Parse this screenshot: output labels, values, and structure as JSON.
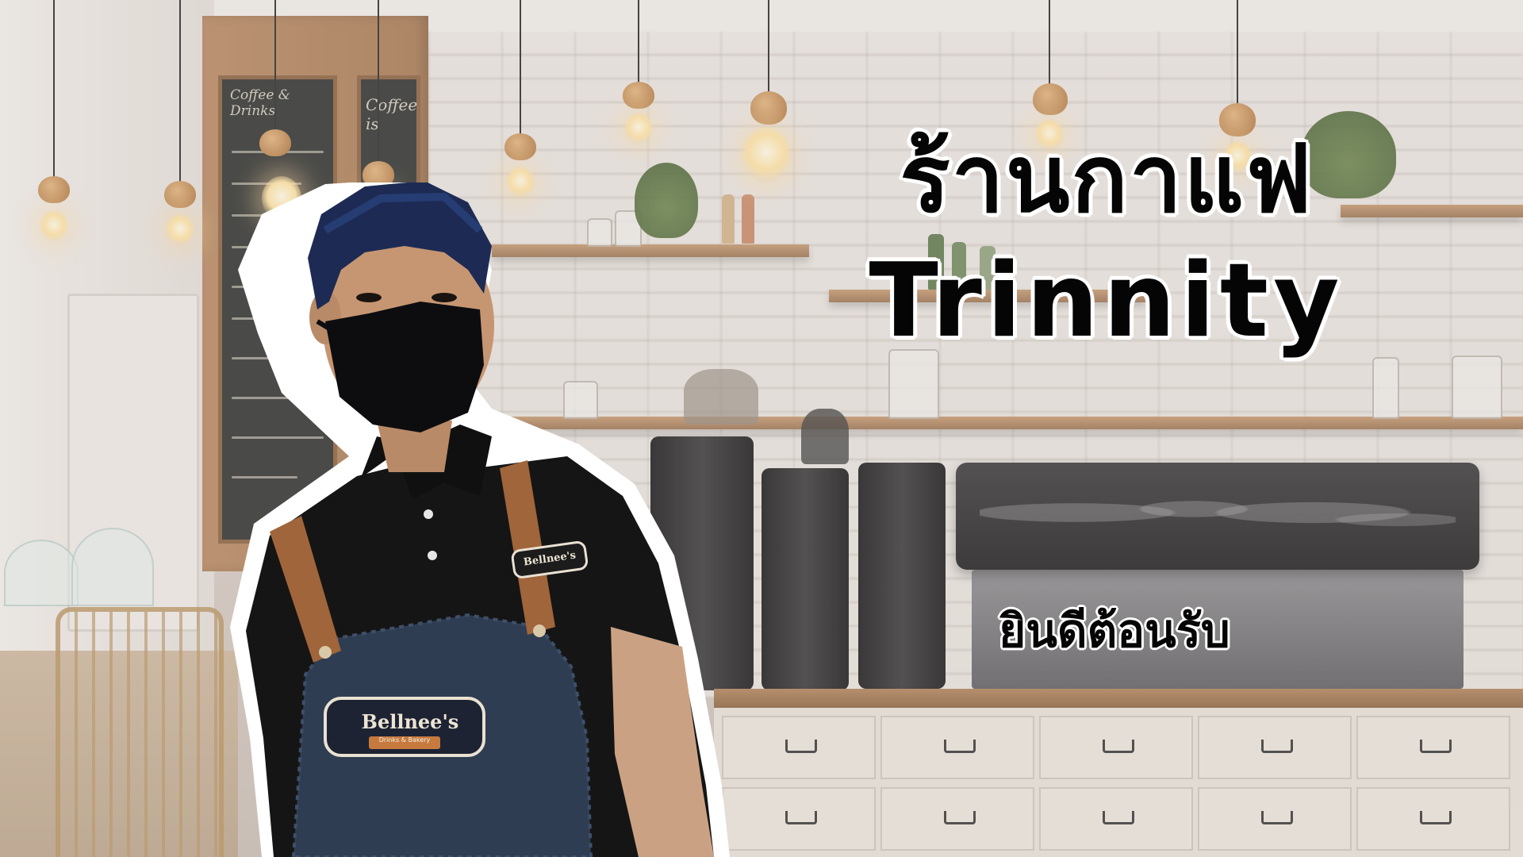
{
  "title": {
    "line1": "ร้านกาแฟ",
    "line2": "Trinnity"
  },
  "subtitle": "ยินดีต้อนรับ",
  "apron_logo": "Bellnee's",
  "apron_logo_tagline": "Drinks & Bakery",
  "chalkboard": {
    "left_top": "Coffee & Drinks",
    "right_top": "Coffee is"
  },
  "colors": {
    "title_text": "#050505",
    "title_outline": "#ffffff",
    "shirt": "#151515",
    "apron": "#2f3d52",
    "apron_strap": "#a0653a"
  }
}
